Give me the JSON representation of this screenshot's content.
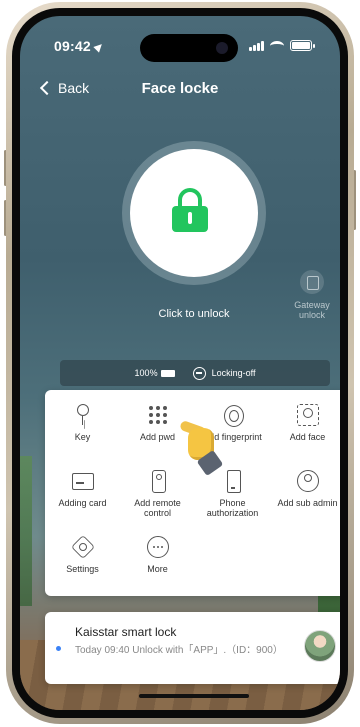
{
  "status_bar": {
    "time": "09:42"
  },
  "nav": {
    "back_label": "Back",
    "title": "Face locke"
  },
  "unlock": {
    "label": "Click to unlock"
  },
  "gateway": {
    "label": "Gateway unlock"
  },
  "lock_status": {
    "battery": "100%",
    "state": "Locking-off"
  },
  "menu": {
    "items": [
      {
        "label": "Key",
        "icon": "key-icon"
      },
      {
        "label": "Add pwd",
        "icon": "keypad-icon"
      },
      {
        "label": "Add fingerprint",
        "icon": "fingerprint-icon"
      },
      {
        "label": "Add face",
        "icon": "face-scan-icon"
      },
      {
        "label": "Adding card",
        "icon": "card-icon"
      },
      {
        "label": "Add remote control",
        "icon": "remote-icon"
      },
      {
        "label": "Phone authorization",
        "icon": "phone-icon"
      },
      {
        "label": "Add sub admin",
        "icon": "sub-admin-icon"
      },
      {
        "label": "Settings",
        "icon": "settings-icon"
      },
      {
        "label": "More",
        "icon": "more-icon"
      }
    ]
  },
  "notification": {
    "title": "Kaisstar smart lock",
    "description": "Today 09:40  Unlock with「APP」.（ID：900）"
  },
  "colors": {
    "accent": "#22c55e",
    "notification_dot": "#3b82f6"
  }
}
